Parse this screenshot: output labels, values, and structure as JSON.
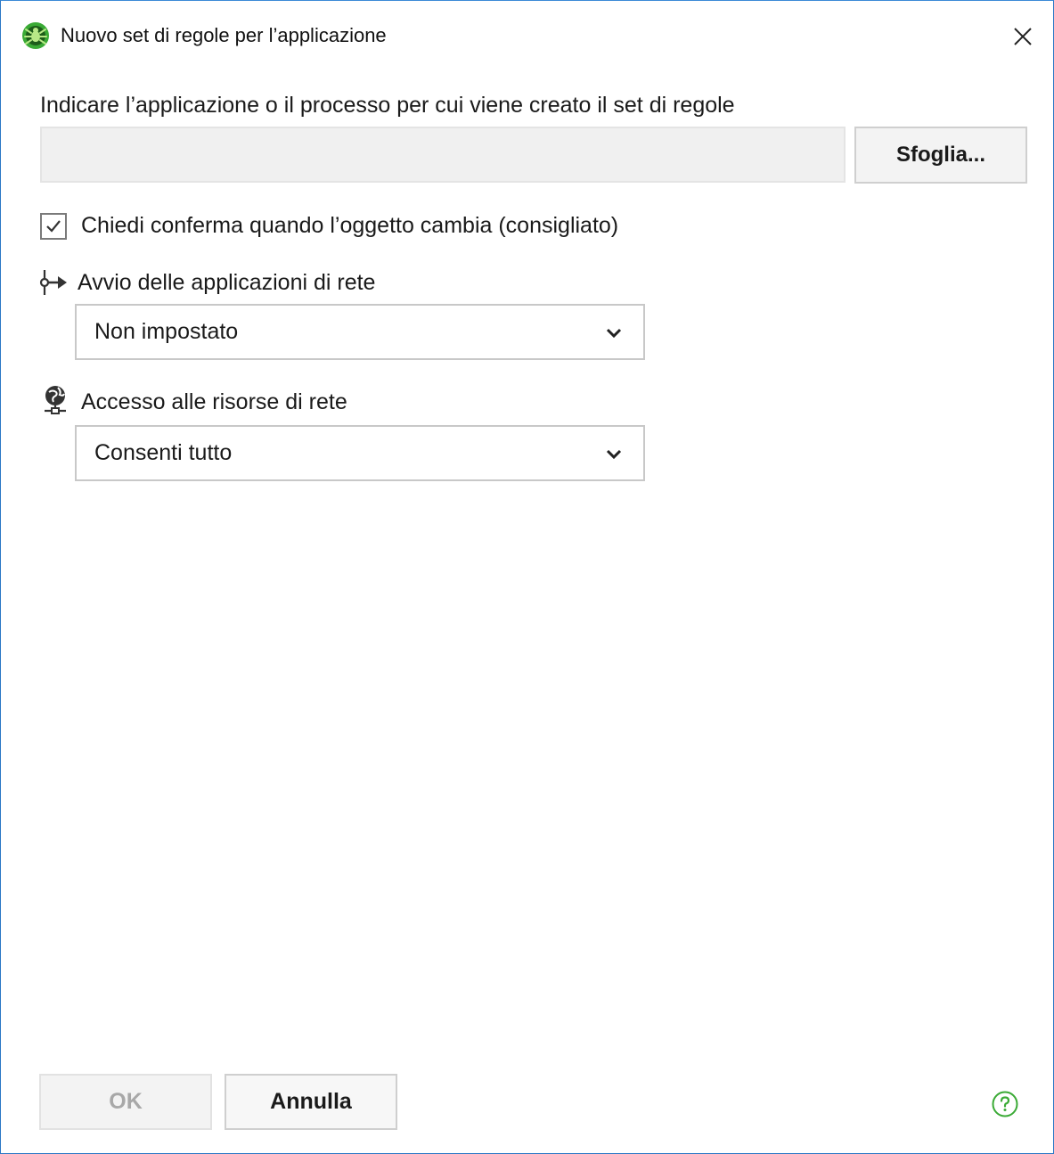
{
  "window": {
    "title": "Nuovo set di regole per l’applicazione",
    "app_icon": "dr-web-spider-icon",
    "close_icon": "close-icon"
  },
  "application": {
    "prompt": "Indicare l’applicazione o il processo per cui viene creato il set di regole",
    "path_value": "",
    "browse_label": "Sfoglia..."
  },
  "confirm_change": {
    "label": "Chiedi conferma quando l’oggetto cambia (consigliato)",
    "checked": true
  },
  "network_app_start": {
    "label": "Avvio delle applicazioni di rete",
    "icon": "network-app-launch-icon",
    "selected": "Non impostato"
  },
  "network_resources": {
    "label": "Accesso alle risorse di rete",
    "icon": "globe-network-icon",
    "selected": "Consenti tutto"
  },
  "footer": {
    "ok_label": "OK",
    "ok_enabled": false,
    "cancel_label": "Annulla",
    "help_icon": "help-icon"
  },
  "colors": {
    "accent_green": "#3aaa35",
    "window_border": "#2b78c5",
    "disabled_text": "#a8a8a8"
  }
}
